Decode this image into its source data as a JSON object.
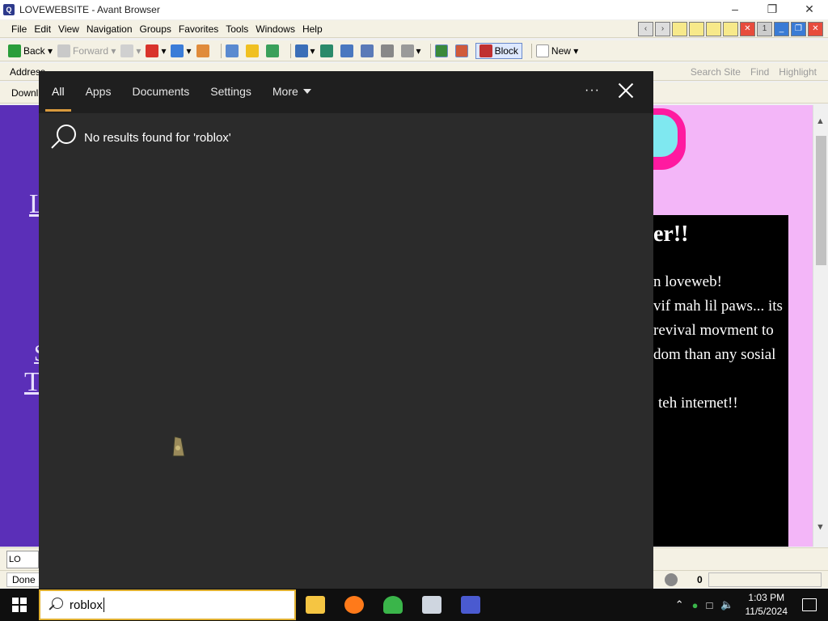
{
  "window": {
    "title": "LOVEWEBSITE - Avant Browser"
  },
  "menu": [
    "File",
    "Edit",
    "View",
    "Navigation",
    "Groups",
    "Favorites",
    "Tools",
    "Windows",
    "Help"
  ],
  "toolbar": {
    "back": "Back",
    "forward": "Forward",
    "block": "Block",
    "new": "New"
  },
  "address_bar": {
    "label": "Address",
    "search_site": "Search Site",
    "find": "Find",
    "highlight": "Highlight"
  },
  "download_bar": {
    "label": "Downl"
  },
  "webpage": {
    "heading": "er!!",
    "lines": [
      "n loveweb!",
      "vif mah lil paws... its",
      "revival movment to",
      "dom than any sosial",
      "teh internet!!"
    ],
    "left_links": [
      "L",
      "S",
      "T"
    ]
  },
  "tabbar": {
    "tab_label": "LO"
  },
  "statusbar": {
    "status": "Done",
    "count": "0"
  },
  "search_panel": {
    "tabs": [
      "All",
      "Apps",
      "Documents",
      "Settings",
      "More"
    ],
    "active_tab": "All",
    "message": "No results found for 'roblox'"
  },
  "taskbar": {
    "search_query": "roblox",
    "time": "1:03 PM",
    "date": "11/5/2024",
    "pinned_apps": [
      "file-explorer",
      "firefox",
      "people-app",
      "remote-desktop",
      "avant-browser"
    ]
  },
  "colors": {
    "accent": "#d99a3d",
    "search_bg": "#2b2b2b",
    "page_bg": "#5b2fb8",
    "pink": "#f3b6f8"
  }
}
